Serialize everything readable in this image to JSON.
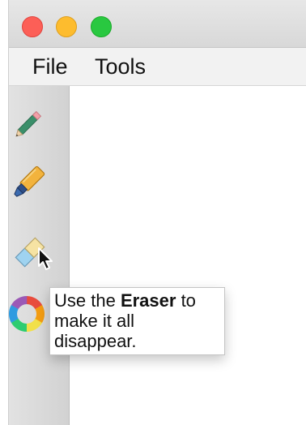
{
  "window": {
    "traffic_lights": {
      "close_color": "#fc5f57",
      "minimize_color": "#fdbc2e",
      "zoom_color": "#29c840"
    }
  },
  "menubar": {
    "file_label": "File",
    "tools_label": "Tools"
  },
  "toolbar": {
    "tools": [
      {
        "icon": "pencil-icon"
      },
      {
        "icon": "highlighter-icon"
      },
      {
        "icon": "eraser-icon"
      },
      {
        "icon": "color-wheel-icon"
      }
    ]
  },
  "tooltip": {
    "prefix": "Use the ",
    "emphasis": "Eraser",
    "suffix": " to make it all disappear."
  }
}
